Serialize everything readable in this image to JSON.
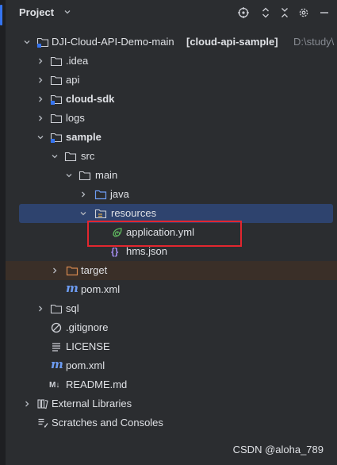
{
  "header": {
    "title": "Project"
  },
  "tree": {
    "root": {
      "name": "DJI-Cloud-API-Demo-main",
      "module": "[cloud-api-sample]",
      "path": "D:\\study\\"
    },
    "idea": ".idea",
    "api": "api",
    "cloud_sdk": "cloud-sdk",
    "logs": "logs",
    "sample": "sample",
    "src": "src",
    "main": "main",
    "java": "java",
    "resources": "resources",
    "application_yml": "application.yml",
    "hms_json": "hms.json",
    "target": "target",
    "sample_pom": "pom.xml",
    "sql": "sql",
    "gitignore": ".gitignore",
    "license": "LICENSE",
    "root_pom": "pom.xml",
    "readme": "README.md",
    "external_libraries": "External Libraries",
    "scratches": "Scratches and Consoles"
  },
  "icons": {
    "m_glyph": "m",
    "md_glyph": "M↓",
    "json_glyph": "{}"
  },
  "watermark": "CSDN @aloha_789",
  "colors": {
    "background": "#2b2d30",
    "selected_row": "#2e436e",
    "excluded_row": "#3a2f28",
    "highlight_box": "#e2262f",
    "folder_blue": "#6d9cf2",
    "folder_orange": "#d5884f"
  }
}
